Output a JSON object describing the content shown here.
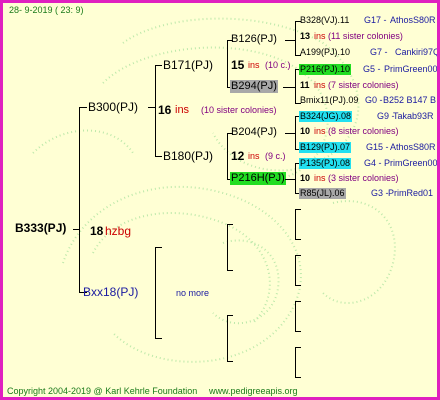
{
  "header": {
    "date": "28-  9-2019  (  23:  9)"
  },
  "root": {
    "name": "B333(PJ)",
    "inbreeding": "18",
    "code": "hzbg"
  },
  "gen1": {
    "father": {
      "name": "B300(PJ)",
      "inbreeding": "16",
      "ins": "ins",
      "note": "(10 sister colonies)"
    },
    "mother": {
      "name": "Bxx18(PJ)",
      "more": "no more"
    }
  },
  "gen2": {
    "ff": {
      "name": "B171(PJ)",
      "inbreeding": "15",
      "ins": "ins",
      "note": "(10 c.)"
    },
    "fm": {
      "name": "B180(PJ)",
      "inbreeding": "12",
      "ins": "ins",
      "note": "(9 c.)"
    }
  },
  "gen3": {
    "fff": {
      "name": "B126(PJ)",
      "inbreeding": "13",
      "ins": "ins",
      "note": "(11 sister colonies)"
    },
    "ffm": {
      "name": "B294(PJ)",
      "inbreeding": "11",
      "ins": "ins",
      "note": "(7 sister colonies)"
    },
    "fmf": {
      "name": "B204(PJ)",
      "inbreeding": "10",
      "ins": "ins",
      "note": "(8 sister colonies)"
    },
    "fmm": {
      "name": "P216H(PJ)",
      "inbreeding": "10",
      "ins": "ins",
      "note": "(3 sister colonies)"
    }
  },
  "gen4": [
    {
      "name": "B328(VJ).11",
      "gen": "G17 -",
      "line": "AthosS80R"
    },
    {
      "name": "A199(PJ).10",
      "gen": "G7 -",
      "line": "Cankiri97Q"
    },
    {
      "name": "P216(PJ).10",
      "gen": "G5 -",
      "line": "PrimGreen00"
    },
    {
      "name": "Bmix11(PJ).09",
      "gen": "G0 -",
      "line": "B252 B147 B"
    },
    {
      "name": "B324(JG).08",
      "gen": "G9 -",
      "line": "Takab93R"
    },
    {
      "name": "B129(PJ).07",
      "gen": "G15 -",
      "line": "AthosS80R"
    },
    {
      "name": "P135(PJ).08",
      "gen": "G4 -",
      "line": "PrimGreen00"
    },
    {
      "name": "R85(JL).06",
      "gen": "G3 -",
      "line": "PrimRed01"
    }
  ],
  "footer": {
    "copyright": "Copyright 2004-2019 @ Karl Kehrle Foundation",
    "url": "www.pedigreeapis.org"
  },
  "colors": {
    "border": "#e020c0",
    "background": "#ffffd4",
    "highlight_green": "#22dd22",
    "highlight_cyan": "#22e0f0",
    "highlight_gray": "#a8a8a8"
  }
}
